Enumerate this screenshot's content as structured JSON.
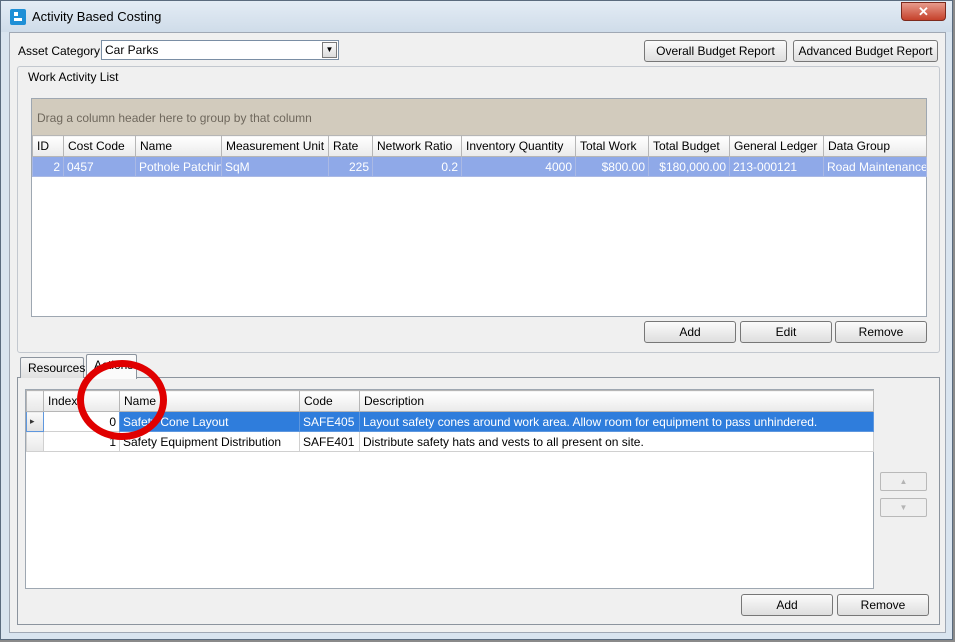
{
  "window": {
    "title": "Activity Based Costing",
    "close_glyph": "✕"
  },
  "asset_category": {
    "label": "Asset Category:",
    "value": "Car Parks"
  },
  "reports": {
    "overall": "Overall Budget Report",
    "advanced": "Advanced Budget Report"
  },
  "work_activity": {
    "group_title": "Work Activity List",
    "group_by_hint": "Drag a column header here to group by that column",
    "columns": [
      "ID",
      "Cost Code",
      "Name",
      "Measurement Unit",
      "Rate",
      "Network Ratio",
      "Inventory Quantity",
      "Total Work",
      "Total Budget",
      "General Ledger",
      "Data Group"
    ],
    "rows": [
      {
        "id": "2",
        "cost_code": "0457",
        "name": "Pothole Patching",
        "unit": "SqM",
        "rate": "225",
        "network_ratio": "0.2",
        "inventory_qty": "4000",
        "total_work": "$800.00",
        "total_budget": "$180,000.00",
        "general_ledger": "213-000121",
        "data_group": "Road Maintenance"
      }
    ],
    "buttons": {
      "add": "Add",
      "edit": "Edit",
      "remove": "Remove"
    }
  },
  "tabs": {
    "resources": "Resources",
    "actions": "Actions"
  },
  "actions": {
    "columns": [
      "Index",
      "Name",
      "Code",
      "Description"
    ],
    "rows": [
      {
        "index": "0",
        "name": "Safety Cone Layout",
        "code": "SAFE405",
        "description": "Layout safety cones around work area. Allow room for equipment to pass unhindered."
      },
      {
        "index": "1",
        "name": "Safety Equipment Distribution",
        "code": "SAFE401",
        "description": "Distribute safety hats and vests to all present on site."
      }
    ],
    "buttons": {
      "add": "Add",
      "remove": "Remove",
      "move_up": "▲",
      "move_down": "▼"
    },
    "current_row_marker": "▸"
  },
  "annotation": {
    "color": "#e00000"
  }
}
